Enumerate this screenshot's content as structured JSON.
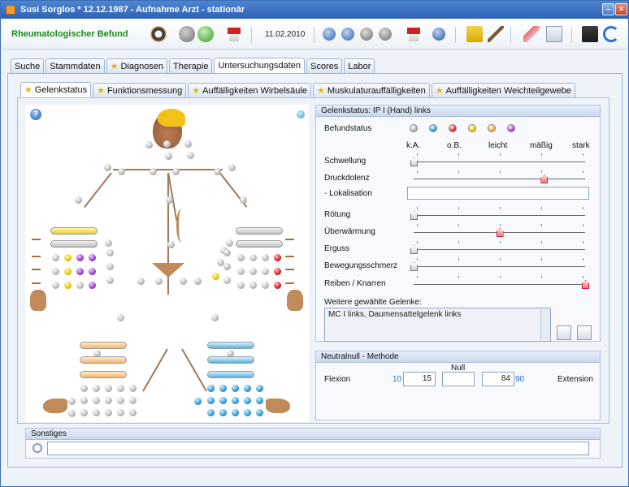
{
  "window": {
    "title": "Susi Sorglos  * 12.12.1987 - Aufnahme Arzt - stationär",
    "min": "–",
    "close": "×"
  },
  "toolbar": {
    "title": "Rheumatologischer Befund",
    "date": "11.02.2010"
  },
  "main_tabs": [
    {
      "label": "Suche",
      "starred": false
    },
    {
      "label": "Stammdaten",
      "starred": false
    },
    {
      "label": "Diagnosen",
      "starred": true
    },
    {
      "label": "Therapie",
      "starred": false
    },
    {
      "label": "Untersuchungsdaten",
      "starred": false,
      "active": true
    },
    {
      "label": "Scores",
      "starred": false
    },
    {
      "label": "Labor",
      "starred": false
    }
  ],
  "sub_tabs": [
    {
      "label": "Gelenkstatus",
      "active": true
    },
    {
      "label": "Funktionsmessung"
    },
    {
      "label": "Auffälligkeiten Wirbelsäule"
    },
    {
      "label": "Muskulaturauffälligkeiten"
    },
    {
      "label": "Auffälligkeiten Weichteilgewebe"
    }
  ],
  "gelenkstatus": {
    "header": "Gelenkstatus: IP I (Hand) links",
    "befundstatus_label": "Befundstatus",
    "status_colors": [
      "#b0b0b0",
      "#2d9ad8",
      "#e02020",
      "#e8c800",
      "#f2a62a",
      "#9b3fd0"
    ],
    "scale_labels": [
      "k.A.",
      "o.B.",
      "leicht",
      "mäßig",
      "stark"
    ],
    "rows": [
      {
        "label": "Schwellung",
        "value": 0
      },
      {
        "label": "Druckdolenz",
        "value": 0.76
      },
      {
        "label": "- Lokalisation",
        "type": "input",
        "value": ""
      },
      {
        "label": "Rötung",
        "value": 0
      },
      {
        "label": "Überwärmung",
        "value": 0.5
      },
      {
        "label": "Erguss",
        "value": 0
      },
      {
        "label": "Bewegungsschmerz",
        "value": 0
      },
      {
        "label": "Reiben / Knarren",
        "value": 1.0
      }
    ],
    "weitere_label": "Weitere gewählte Gelenke:",
    "weitere_value": "MC I links, Daumensattelgelenk links"
  },
  "neutralnull": {
    "header": "Neutralnull - Methode",
    "null_label": "Null",
    "flexion_label": "Flexion",
    "flexion_max": "10",
    "flexion_value": "15",
    "null_value": "",
    "extension_value": "84",
    "extension_max": "90",
    "extension_label": "Extension"
  },
  "sonstiges": {
    "header": "Sonstiges",
    "value": ""
  },
  "icons": [
    "help-icon",
    "info-icon",
    "search-icon",
    "home-icon",
    "back-icon",
    "forward-icon",
    "first-icon",
    "prev-icon",
    "next-icon",
    "last-icon",
    "print-icon",
    "edit-icon",
    "eraser-icon",
    "copy-icon",
    "save-icon",
    "refresh-icon"
  ]
}
